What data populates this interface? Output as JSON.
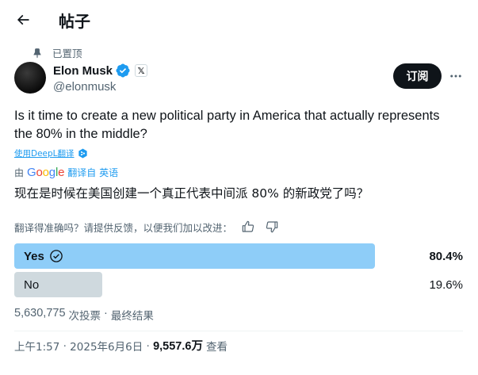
{
  "header": {
    "title": "帖子",
    "back_icon": "arrow-left-icon"
  },
  "pinned": {
    "label": "已置顶",
    "icon": "pin-icon"
  },
  "author": {
    "name": "Elon Musk",
    "handle": "@elonmusk",
    "verified_color": "#1d9bf0",
    "affiliation_badge": "𝕏"
  },
  "actions": {
    "subscribe_label": "订阅",
    "more_icon": "more-horizontal-icon"
  },
  "tweet": {
    "text": "Is it time to create a new political party in America that actually represents the 80% in the middle?",
    "translate_link": "使用DeepL翻译",
    "translated_by_prefix": "由",
    "translated_by_logo": [
      "G",
      "o",
      "o",
      "g",
      "l",
      "e"
    ],
    "translated_from": "翻译自 英语",
    "translated_text": "现在是时候在美国创建一个真正代表中间派 80% 的新政党了吗？",
    "feedback_prompt": "翻译得准确吗？请提供反馈，以便我们加以改进："
  },
  "poll": {
    "options": [
      {
        "label": "Yes",
        "percent": "80.4%",
        "fraction": 0.804,
        "winner": true,
        "bar_color": "#8ecdf8"
      },
      {
        "label": "No",
        "percent": "19.6%",
        "fraction": 0.196,
        "winner": false,
        "bar_color": "#cfd9de"
      }
    ],
    "votes": "5,630,775",
    "votes_suffix": "次投票",
    "separator": "·",
    "status": "最终结果"
  },
  "meta": {
    "time": "上午1:57",
    "separator": "·",
    "date": "2025年6月6日",
    "separator2": "·",
    "views": "9,557.6万",
    "views_suffix": "查看"
  }
}
